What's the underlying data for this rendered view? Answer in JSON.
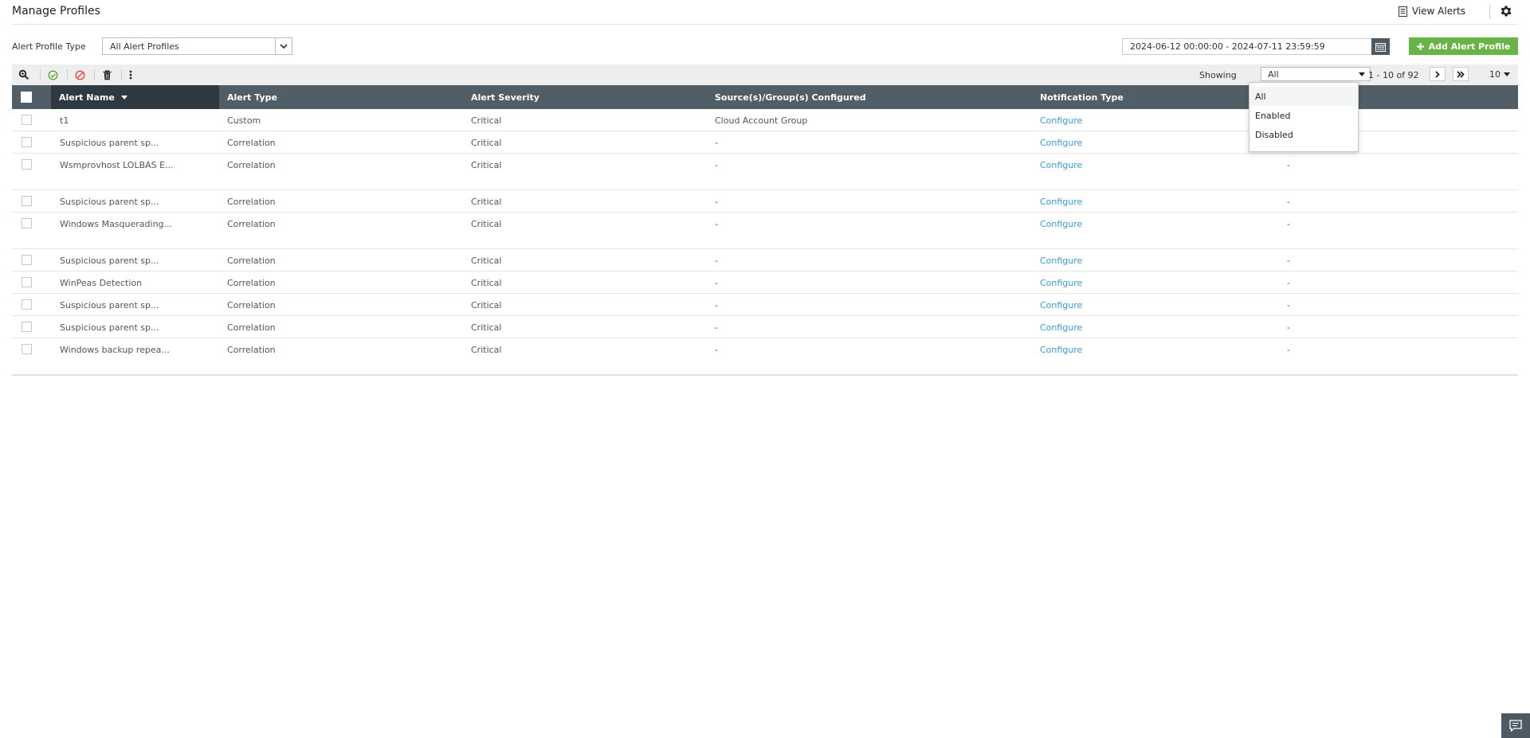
{
  "header": {
    "title": "Manage Profiles",
    "view_alerts_label": "View Alerts"
  },
  "filters": {
    "alert_profile_type_label": "Alert Profile Type",
    "alert_profile_type_value": "All Alert Profiles",
    "date_range": "2024-06-12 00:00:00 - 2024-07-11 23:59:59",
    "add_button_label": "Add Alert Profile"
  },
  "toolbar": {
    "showing_label": "Showing",
    "showing_value": "All",
    "page_info": "1 - 10 of 92",
    "per_page": "10"
  },
  "dropdown": {
    "options": [
      "All",
      "Enabled",
      "Disabled"
    ],
    "selected": "All"
  },
  "table": {
    "columns": [
      "Alert Name",
      "Alert Type",
      "Alert Severity",
      "Source(s)/Group(s) Configured",
      "Notification Type"
    ],
    "rows": [
      {
        "name": "t1",
        "type": "Custom",
        "severity": "Critical",
        "source": "Cloud Account Group",
        "notification": "Configure",
        "extra": "",
        "tall": false
      },
      {
        "name": "Suspicious parent sp...",
        "type": "Correlation",
        "severity": "Critical",
        "source": "-",
        "notification": "Configure",
        "extra": "",
        "tall": false
      },
      {
        "name": "Wsmprovhost LOLBAS E...",
        "type": "Correlation",
        "severity": "Critical",
        "source": "-",
        "notification": "Configure",
        "extra": "-",
        "tall": true
      },
      {
        "name": "Suspicious parent sp...",
        "type": "Correlation",
        "severity": "Critical",
        "source": "-",
        "notification": "Configure",
        "extra": "-",
        "tall": false
      },
      {
        "name": "Windows Masquerading...",
        "type": "Correlation",
        "severity": "Critical",
        "source": "-",
        "notification": "Configure",
        "extra": "-",
        "tall": true
      },
      {
        "name": "Suspicious parent sp...",
        "type": "Correlation",
        "severity": "Critical",
        "source": "-",
        "notification": "Configure",
        "extra": "-",
        "tall": false
      },
      {
        "name": "WinPeas Detection",
        "type": "Correlation",
        "severity": "Critical",
        "source": "-",
        "notification": "Configure",
        "extra": "-",
        "tall": false
      },
      {
        "name": "Suspicious parent sp...",
        "type": "Correlation",
        "severity": "Critical",
        "source": "-",
        "notification": "Configure",
        "extra": "-",
        "tall": false
      },
      {
        "name": "Suspicious parent sp...",
        "type": "Correlation",
        "severity": "Critical",
        "source": "-",
        "notification": "Configure",
        "extra": "-",
        "tall": false
      },
      {
        "name": "Windows backup repea...",
        "type": "Correlation",
        "severity": "Critical",
        "source": "-",
        "notification": "Configure",
        "extra": "-",
        "tall": true
      }
    ]
  },
  "colors": {
    "header_bg": "#515e67",
    "sorted_header_bg": "#2f3941",
    "accent_green": "#68b446",
    "link": "#3a9ad9"
  },
  "icons": [
    "document-icon",
    "gear-icon",
    "search-icon",
    "enable-icon",
    "disable-icon",
    "delete-icon",
    "more-vertical-icon",
    "calendar-icon",
    "plus-icon",
    "chevron-down-icon",
    "next-page-icon",
    "last-page-icon",
    "sort-desc-icon",
    "chat-icon"
  ]
}
